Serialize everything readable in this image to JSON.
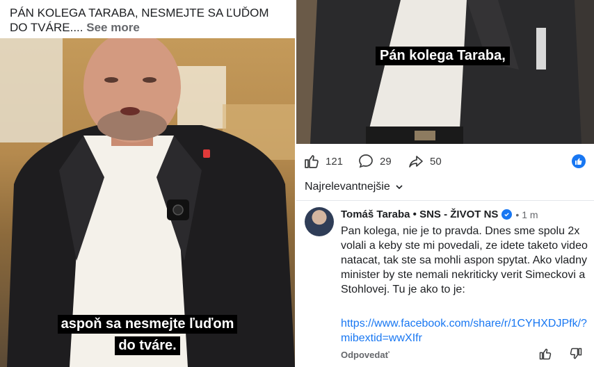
{
  "left_post": {
    "caption": "PÁN KOLEGA TARABA, NESMEJTE SA ĽUĎOM DO TVÁRE....",
    "see_more": "See more",
    "subtitle_line1": "aspoň sa nesmejte ľuďom",
    "subtitle_line2": "do tváre."
  },
  "right_video": {
    "subtitle": "Pán kolega Taraba,"
  },
  "actions": {
    "likes": "121",
    "comments": "29",
    "shares": "50"
  },
  "sort": {
    "label": "Najrelevantnejšie"
  },
  "comment": {
    "author": "Tomáš Taraba • SNS - ŽIVOT NS",
    "time": "• 1 m",
    "text": "Pan kolega, nie je to pravda. Dnes sme spolu 2x volali a keby ste mi povedali, ze idete taketo video natacat, tak ste sa mohli aspon spytat. Ako vladny minister by ste nemali nekriticky verit Simeckovi a Stohlovej. Tu je ako to je:",
    "link": "https://www.facebook.com/share/r/1CYHXDJPfk/?mibextid=wwXIfr",
    "reply": "Odpovedať"
  },
  "colors": {
    "accent": "#1877f2",
    "text": "#1c1e21",
    "muted": "#65676b"
  }
}
